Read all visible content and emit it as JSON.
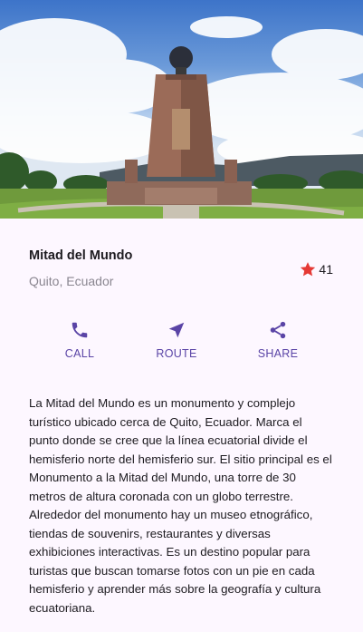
{
  "hero": {
    "image_icon": "mitad-del-mundo-monument-photo"
  },
  "place": {
    "title": "Mitad del Mundo",
    "subtitle": "Quito, Ecuador"
  },
  "rating": {
    "icon": "star-icon",
    "count": "41",
    "color": "#e53935"
  },
  "actions": [
    {
      "icon": "phone-icon",
      "label": "CALL"
    },
    {
      "icon": "navigation-arrow-icon",
      "label": "ROUTE"
    },
    {
      "icon": "share-icon",
      "label": "SHARE"
    }
  ],
  "accent_color": "#5a44a6",
  "description": "La Mitad del Mundo es un monumento y complejo turístico ubicado cerca de Quito, Ecuador. Marca el punto donde se cree que la línea ecuatorial divide el hemisferio norte del hemisferio sur. El sitio principal es el Monumento a la Mitad del Mundo, una torre de 30 metros de altura coronada con un globo terrestre. Alrededor del monumento hay un museo etnográfico, tiendas de souvenirs, restaurantes y diversas exhibiciones interactivas. Es un destino popular para turistas que buscan tomarse fotos con un pie en cada hemisferio y aprender más sobre la geografía y cultura ecuatoriana."
}
